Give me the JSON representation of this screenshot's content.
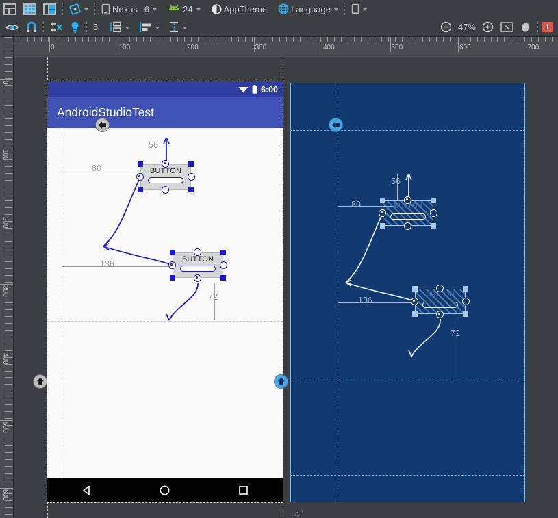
{
  "toolbar_top": {
    "view_modes": [
      {
        "name": "design-mode",
        "label": "Design"
      },
      {
        "name": "blueprint-mode",
        "label": "Blueprint",
        "active": true
      },
      {
        "name": "both-mode",
        "label": "Design + Blueprint"
      }
    ],
    "orientation_label": "Orientation",
    "device_label": "Nexus",
    "device_size": "6",
    "api_level": "24",
    "theme_label": "AppTheme",
    "locale_label": "Language",
    "variant_label": "Variant"
  },
  "toolbar_second": {
    "show_constraints_label": "Show Constraints",
    "autoconnect_label": "Turn On Autoconnect",
    "clear_constraints_label": "Clear All Constraints",
    "infer_constraints_label": "Infer Constraints",
    "default_margin_value": "8",
    "pack_label": "Pack",
    "align_label": "Align",
    "guidelines_label": "Guidelines",
    "zoom_out_label": "Zoom Out",
    "zoom_level": "47%",
    "zoom_in_label": "Zoom In",
    "zoom_fit_label": "Zoom to Fit",
    "pan_label": "Pan Tool",
    "issue_count": "1"
  },
  "ruler": {
    "horizontal_labels": [
      "0",
      "100",
      "200",
      "300",
      "400",
      "500",
      "600",
      "700"
    ],
    "vertical_labels": [
      "0",
      "100",
      "200",
      "300",
      "400",
      "500",
      "600"
    ]
  },
  "device_preview": {
    "status_time": "6:00",
    "wifi_icon": "wifi-icon",
    "battery_icon": "battery-icon",
    "app_title": "AndroidStudioTest",
    "nav_back": "back-triangle-icon",
    "nav_home": "home-circle-icon",
    "nav_recents": "recents-square-icon"
  },
  "widgets": {
    "button1": {
      "text": "BUTTON",
      "margin_top": "56",
      "margin_left": "80"
    },
    "button2": {
      "text": "BUTTON",
      "margin_left": "136",
      "margin_bottom": "72"
    }
  },
  "colors": {
    "accent_blue": "#1a1ad0",
    "app_bar": "#3f51b5",
    "status_bar": "#303f9f",
    "blueprint_bg": "#133a70",
    "toolbar_bg": "#3c3f41",
    "warning_red": "#d9534f"
  }
}
